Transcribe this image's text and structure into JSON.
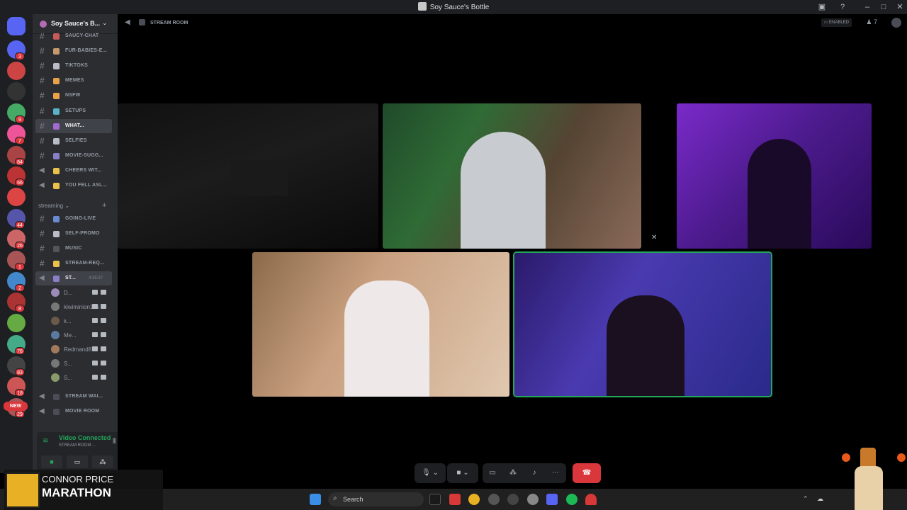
{
  "window": {
    "title": "Soy Sauce's Bottle"
  },
  "server": {
    "name": "Soy Sauce's B..."
  },
  "channels": [
    {
      "label": "SAUCY-CHAT",
      "color": "#c75a5a"
    },
    {
      "label": "FUR-BABIES-E...",
      "color": "#c49a6c"
    },
    {
      "label": "TIKTOKS",
      "color": "#b8bcc4"
    },
    {
      "label": "MEMES",
      "color": "#e8a24a"
    },
    {
      "label": "NSFW",
      "color": "#e8a24a"
    },
    {
      "label": "SETUPS",
      "color": "#5ab4c9"
    },
    {
      "label": "WHAT...",
      "color": "#a36bd1"
    },
    {
      "label": "SELFIES",
      "color": "#b8bcc4"
    },
    {
      "label": "MOVIE-SUGG...",
      "color": "#8a7fc7"
    },
    {
      "label": "CHEERS WIT...",
      "color": "#e8c24a"
    },
    {
      "label": "YOU FELL ASL...",
      "color": "#e8c24a"
    }
  ],
  "category": {
    "label": "streaming"
  },
  "stream_channels": [
    {
      "label": "GOING-LIVE",
      "color": "#6b8ad1"
    },
    {
      "label": "SELF-PROMO",
      "color": "#b8bcc4"
    },
    {
      "label": "MUSIC",
      "color": "#555"
    },
    {
      "label": "STREAM-REQ...",
      "color": "#e8c24a"
    },
    {
      "label": "ST...",
      "color": "#8a7fc7",
      "time": "4:35:37"
    }
  ],
  "voice_users": [
    {
      "name": "D...",
      "color": "#9b8bb7"
    },
    {
      "name": "kiwiminion145",
      "color": "#777"
    },
    {
      "name": "k...",
      "color": "#6b5a4a"
    },
    {
      "name": "Me...",
      "color": "#5a7aa0"
    },
    {
      "name": "Redmand87",
      "color": "#a07a5a"
    },
    {
      "name": "S...",
      "color": "#777"
    },
    {
      "name": "S...",
      "color": "#8a9a6a"
    }
  ],
  "bottom_channels": [
    {
      "label": "STREAM WAI..."
    },
    {
      "label": "MOVIE ROOM"
    }
  ],
  "voice_panel": {
    "status": "Video Connected",
    "sub": "STREAM ROOM ..."
  },
  "stage": {
    "channel": "STREAM ROOM",
    "enabled_label": "ENABLED",
    "member_count": "7"
  },
  "servers": [
    {
      "badge": "3",
      "color": "#5865f2"
    },
    {
      "badge": "",
      "color": "#c44"
    },
    {
      "badge": "",
      "color": "#333"
    },
    {
      "badge": "9",
      "color": "#4a6"
    },
    {
      "badge": "7",
      "color": "#e59"
    },
    {
      "badge": "84",
      "color": "#a44"
    },
    {
      "badge": "66",
      "color": "#b33"
    },
    {
      "badge": "",
      "color": "#d44"
    },
    {
      "badge": "44",
      "color": "#55a"
    },
    {
      "badge": "26",
      "color": "#c66"
    },
    {
      "badge": "1",
      "color": "#a55"
    },
    {
      "badge": "2",
      "color": "#48c"
    },
    {
      "badge": "8",
      "color": "#a33"
    },
    {
      "badge": "",
      "color": "#6a4"
    },
    {
      "badge": "76",
      "color": "#4a8"
    },
    {
      "badge": "83",
      "color": "#444"
    },
    {
      "badge": "18",
      "color": "#c55"
    },
    {
      "badge": "29",
      "color": "#a55"
    }
  ],
  "new_label": "NEW",
  "taskbar": {
    "search": "Search"
  },
  "overlay": {
    "line1": "CONNOR PRICE",
    "line2": "MARATHON"
  }
}
